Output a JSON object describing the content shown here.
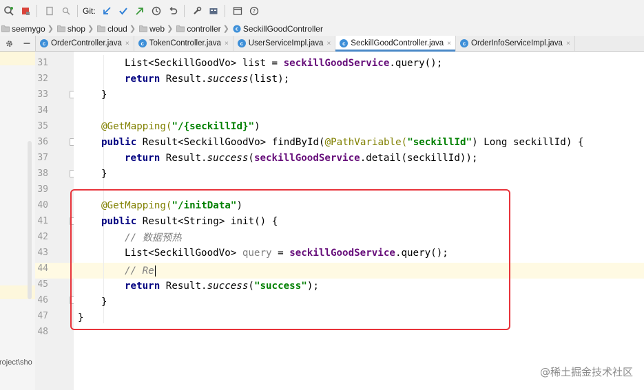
{
  "toolbar": {
    "git_label": "Git:"
  },
  "breadcrumb": [
    {
      "label": "seemygo",
      "icon": "folder-icon"
    },
    {
      "label": "shop",
      "icon": "folder-icon"
    },
    {
      "label": "cloud",
      "icon": "folder-icon"
    },
    {
      "label": "web",
      "icon": "folder-icon"
    },
    {
      "label": "controller",
      "icon": "folder-icon"
    },
    {
      "label": "SeckillGoodController",
      "icon": "class-icon"
    }
  ],
  "tabs": [
    {
      "label": "OrderController.java",
      "active": false
    },
    {
      "label": "TokenController.java",
      "active": false
    },
    {
      "label": "UserServiceImpl.java",
      "active": false
    },
    {
      "label": "SeckillGoodController.java",
      "active": true
    },
    {
      "label": "OrderInfoServiceImpl.java",
      "active": false
    }
  ],
  "tab_close_glyph": "×",
  "tab_icon_glyph": "c",
  "project_panel_text": "roject\\sho",
  "line_numbers": [
    "31",
    "32",
    "33",
    "34",
    "35",
    "36",
    "37",
    "38",
    "39",
    "40",
    "41",
    "42",
    "43",
    "44",
    "45",
    "46",
    "47",
    "48"
  ],
  "code": {
    "l31": {
      "a": "List<SeckillGoodVo> list = ",
      "b": "seckillGoodService",
      "c": ".query();"
    },
    "l32": {
      "a": "return",
      "b": " Result.",
      "c": "success",
      "d": "(list);"
    },
    "l33": {
      "a": "}"
    },
    "l35": {
      "a": "@GetMapping(",
      "b": "\"/{seckillId}\"",
      "c": ")"
    },
    "l36": {
      "a": "public",
      "b": " Result<SeckillGoodVo> findById(",
      "c": "@PathVariable(",
      "d": "\"seckillId\"",
      "e": ") Long seckillId) {"
    },
    "l37": {
      "a": "return",
      "b": " Result.",
      "c": "success",
      "d": "(",
      "e": "seckillGoodService",
      "f": ".detail(seckillId));"
    },
    "l38": {
      "a": "}"
    },
    "l40": {
      "a": "@GetMapping(",
      "b": "\"/initData\"",
      "c": ")"
    },
    "l41": {
      "a": "public",
      "b": " Result<String> init() {"
    },
    "l42": {
      "a": "// 数据预热"
    },
    "l43": {
      "a": "List<SeckillGoodVo> ",
      "b": "query",
      "c": " = ",
      "d": "seckillGoodService",
      "e": ".query();"
    },
    "l44": {
      "a": "// Re"
    },
    "l45": {
      "a": "return",
      "b": " Result.",
      "c": "success",
      "d": "(",
      "e": "\"success\"",
      "f": ");"
    },
    "l46": {
      "a": "}"
    },
    "l47": {
      "a": "}"
    }
  },
  "watermark": "@稀土掘金技术社区",
  "colors": {
    "keyword": "#000080",
    "string": "#008000",
    "annotation": "#808000",
    "field": "#660e7a",
    "comment": "#808080",
    "highlight_box": "#e8333a",
    "active_tab_underline": "#4a88c7"
  }
}
